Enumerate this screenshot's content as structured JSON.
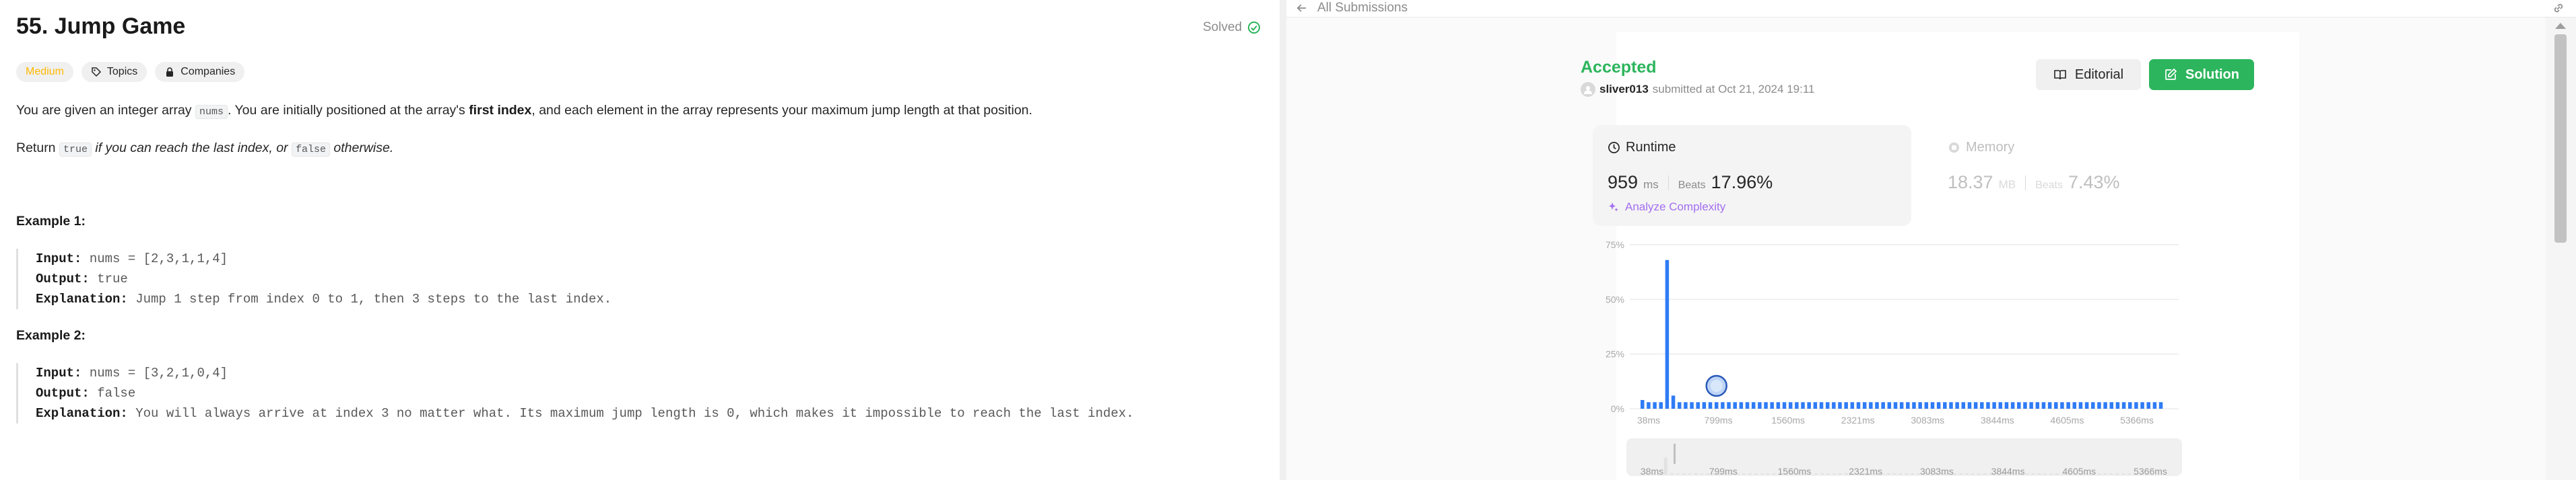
{
  "problem": {
    "title": "55. Jump Game",
    "solved_label": "Solved",
    "tags": {
      "difficulty": "Medium",
      "topics": "Topics",
      "companies": "Companies"
    },
    "description": {
      "p1_a": "You are given an integer array ",
      "p1_code": "nums",
      "p1_b": ". You are initially positioned at the array's ",
      "p1_bold": "first index",
      "p1_c": ", and each element in the array represents your maximum jump length at that position.",
      "p2_a": "Return ",
      "p2_code1": "true",
      "p2_italic": " if you can reach the last index, or ",
      "p2_code2": "false",
      "p2_b": " otherwise."
    },
    "examples": [
      {
        "heading": "Example 1:",
        "input_label": "Input:",
        "input": " nums = [2,3,1,1,4]",
        "output_label": "Output:",
        "output": " true",
        "explanation_label": "Explanation:",
        "explanation": " Jump 1 step from index 0 to 1, then 3 steps to the last index."
      },
      {
        "heading": "Example 2:",
        "input_label": "Input:",
        "input": " nums = [3,2,1,0,4]",
        "output_label": "Output:",
        "output": " false",
        "explanation_label": "Explanation:",
        "explanation": " You will always arrive at index 3 no matter what. Its maximum jump length is 0, which makes it impossible to reach the last index."
      }
    ]
  },
  "submission": {
    "back_label": "All Submissions",
    "status": "Accepted",
    "user": "sliver013",
    "submitted_text": "submitted at Oct 21, 2024 19:11",
    "editorial_label": "Editorial",
    "solution_label": "Solution",
    "runtime": {
      "label": "Runtime",
      "value": "959",
      "unit": "ms",
      "beats_label": "Beats",
      "beats": "17.96%",
      "analyze_label": "Analyze Complexity"
    },
    "memory": {
      "label": "Memory",
      "value": "18.37",
      "unit": "MB",
      "beats_label": "Beats",
      "beats": "7.43%"
    }
  },
  "colors": {
    "accent_green": "#2db55d",
    "bar_blue": "#2f7bf5",
    "medium_orange": "#ffb800",
    "purple": "#a46ef0"
  },
  "chart_data": {
    "type": "bar",
    "ylim": [
      0,
      75
    ],
    "y_ticks": [
      "75%",
      "50%",
      "25%",
      "0%"
    ],
    "x_ticks": [
      "38ms",
      "799ms",
      "1560ms",
      "2321ms",
      "3083ms",
      "3844ms",
      "4605ms",
      "5366ms"
    ],
    "nav_ticks": [
      "38ms",
      "799ms",
      "1560ms",
      "2321ms",
      "3083ms",
      "3844ms",
      "4605ms",
      "5366ms"
    ],
    "values": [
      4,
      3,
      3,
      3,
      68,
      6,
      3,
      3,
      3,
      3,
      3,
      3,
      3,
      3,
      3,
      3,
      3,
      3,
      3,
      3,
      3,
      3,
      3,
      3,
      3,
      3,
      3,
      3,
      3,
      3,
      3,
      3,
      3,
      3,
      3,
      3,
      3,
      3,
      3,
      3,
      3,
      3,
      3,
      3,
      3,
      3,
      3,
      3,
      3,
      3,
      3,
      3,
      3,
      3,
      3,
      3,
      3,
      3,
      3,
      3,
      3,
      3,
      3,
      3,
      3,
      3,
      3,
      3,
      3,
      3,
      3,
      3,
      3,
      3,
      3,
      3,
      3,
      3,
      3,
      3,
      3,
      3,
      3,
      3,
      3
    ],
    "highlight_index": 12,
    "grid": true
  }
}
